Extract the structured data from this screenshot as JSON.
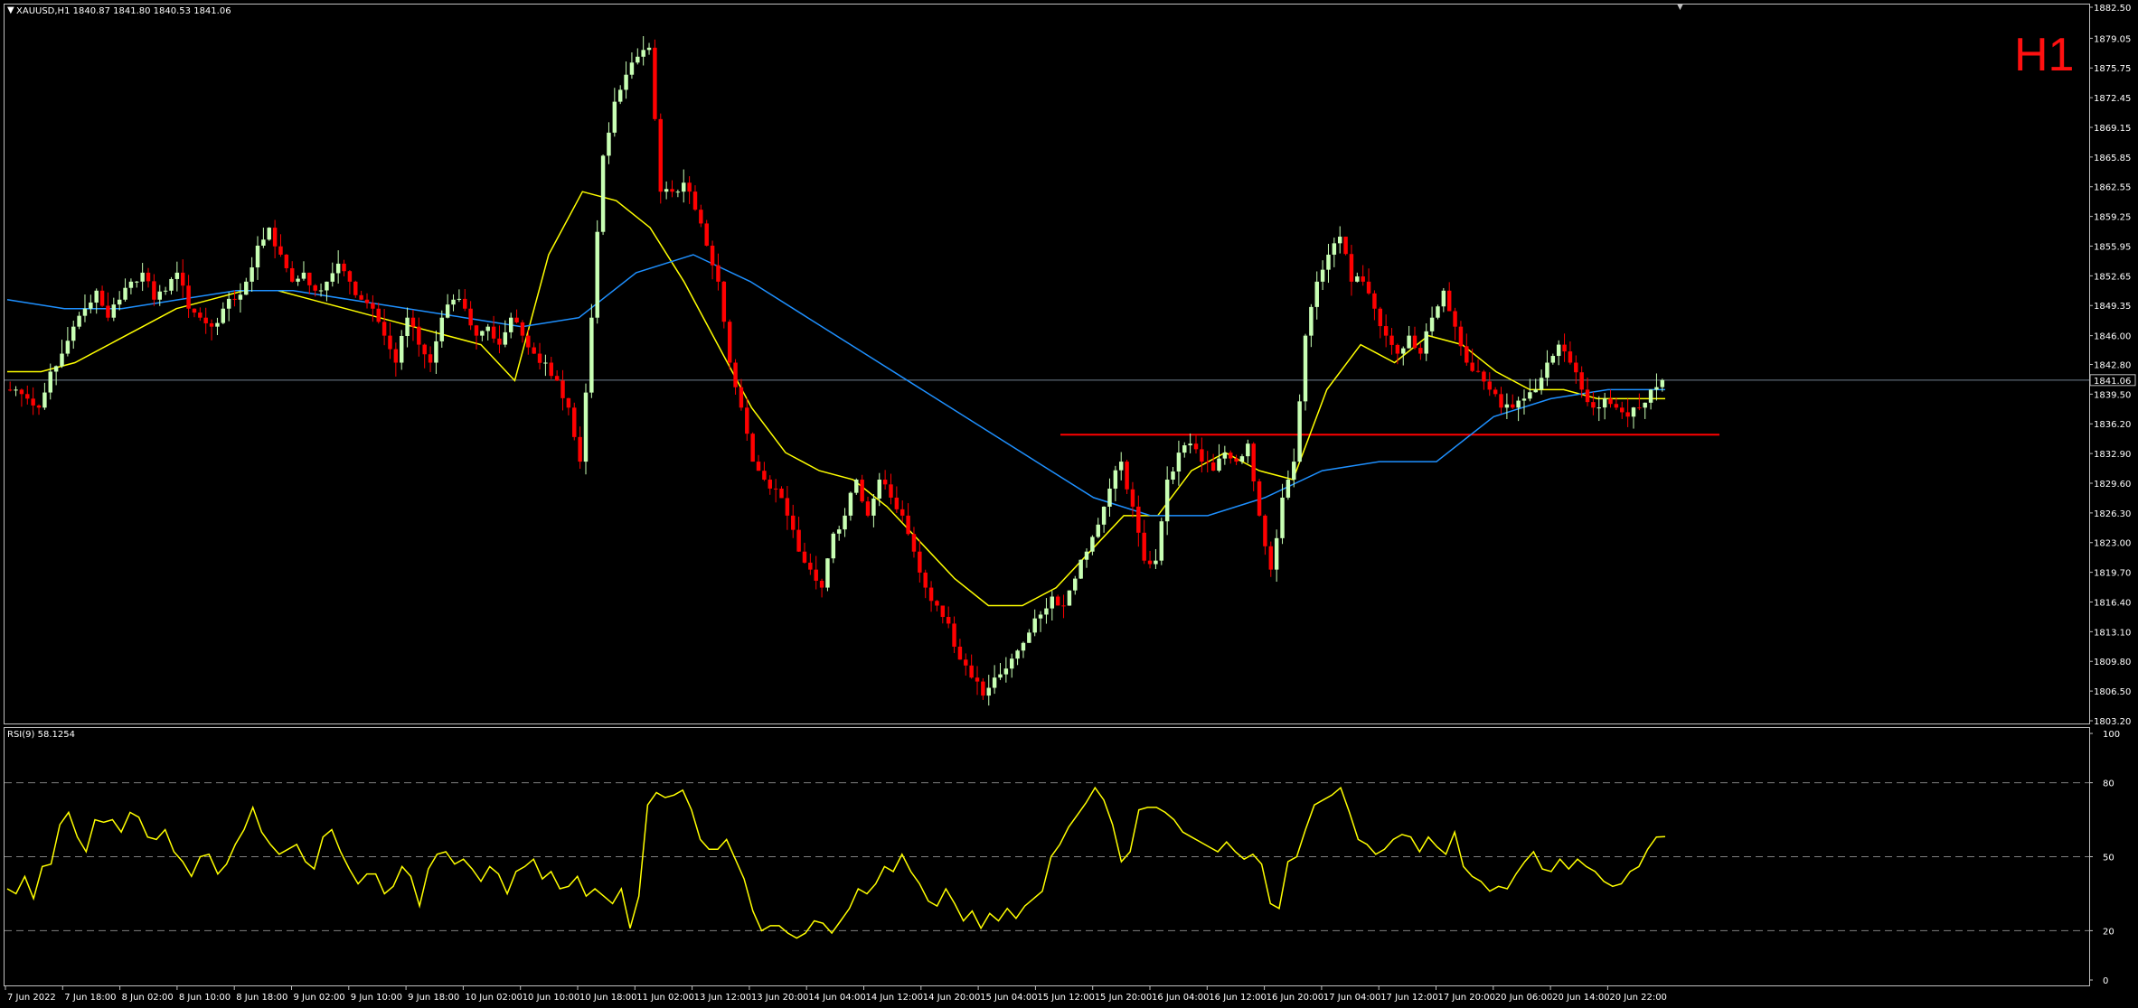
{
  "header": {
    "symbol_info": "XAUUSD,H1  1840.87 1841.80 1840.53 1841.06",
    "timeframe": "H1",
    "rsi_info": "RSI(9) 58.1254"
  },
  "colors": {
    "background": "#000000",
    "bull": "#c8ffb4",
    "bear": "#ff0000",
    "ma_fast": "#ffff00",
    "ma_slow": "#1e90ff",
    "rsi": "#ffff00",
    "support_line": "#ff0000",
    "current_price_line": "#708090"
  },
  "chart_data": [
    {
      "type": "candlestick",
      "symbol": "XAUUSD",
      "timeframe": "H1",
      "last": {
        "open": 1840.87,
        "high": 1841.8,
        "low": 1840.53,
        "close": 1841.06
      },
      "current_price_label": "1841.06",
      "ylim": [
        1803.2,
        1882.5
      ],
      "y_ticks": [
        "1882.50",
        "1879.05",
        "1875.75",
        "1872.45",
        "1869.15",
        "1865.85",
        "1862.55",
        "1859.25",
        "1855.95",
        "1852.65",
        "1849.35",
        "1846.00",
        "1842.80",
        "1839.50",
        "1836.20",
        "1832.90",
        "1829.60",
        "1826.30",
        "1823.00",
        "1819.70",
        "1816.40",
        "1813.10",
        "1809.80",
        "1806.50",
        "1803.20"
      ],
      "x_ticks": [
        "7 Jun 2022",
        "7 Jun 18:00",
        "8 Jun 02:00",
        "8 Jun 10:00",
        "8 Jun 18:00",
        "9 Jun 02:00",
        "9 Jun 10:00",
        "9 Jun 18:00",
        "10 Jun 02:00",
        "10 Jun 10:00",
        "10 Jun 18:00",
        "11 Jun 02:00",
        "13 Jun 12:00",
        "13 Jun 20:00",
        "14 Jun 04:00",
        "14 Jun 12:00",
        "14 Jun 20:00",
        "15 Jun 04:00",
        "15 Jun 12:00",
        "15 Jun 20:00",
        "16 Jun 04:00",
        "16 Jun 12:00",
        "16 Jun 20:00",
        "17 Jun 04:00",
        "17 Jun 12:00",
        "17 Jun 20:00",
        "20 Jun 06:00",
        "20 Jun 14:00",
        "20 Jun 22:00"
      ],
      "support_level": 1835.0,
      "series": [
        {
          "kind": "close_path",
          "values": [
            1840,
            1839,
            1838,
            1842,
            1844,
            1847,
            1849,
            1851,
            1848,
            1850,
            1852,
            1853,
            1850,
            1851,
            1853,
            1849,
            1848,
            1847,
            1849,
            1850,
            1852,
            1856,
            1858,
            1855,
            1852,
            1853,
            1851,
            1852,
            1854,
            1852,
            1850,
            1849,
            1846,
            1843,
            1848,
            1845,
            1843,
            1848,
            1850,
            1849,
            1846,
            1847,
            1845,
            1848,
            1846,
            1844,
            1843,
            1841,
            1838,
            1832,
            1848,
            1866,
            1872,
            1875,
            1877,
            1878,
            1862,
            1862,
            1863,
            1860,
            1856,
            1852,
            1843,
            1838,
            1832,
            1830,
            1829,
            1826,
            1822,
            1820,
            1818,
            1824,
            1826,
            1830,
            1826,
            1830,
            1828,
            1826,
            1822,
            1818,
            1816,
            1814,
            1810,
            1808,
            1806,
            1808,
            1809,
            1811,
            1813,
            1815,
            1817,
            1816,
            1819,
            1822,
            1825,
            1829,
            1832,
            1827,
            1821,
            1821,
            1830,
            1833,
            1834,
            1832,
            1831,
            1833,
            1832,
            1834,
            1826,
            1820,
            1828,
            1832,
            1846,
            1852,
            1855,
            1857,
            1852,
            1852,
            1849,
            1846,
            1844,
            1846,
            1844,
            1848,
            1851,
            1847,
            1843,
            1842,
            1840,
            1838,
            1838,
            1839,
            1840,
            1843,
            1845,
            1843,
            1840,
            1838,
            1839,
            1838,
            1837,
            1838,
            1840,
            1841.06
          ]
        },
        {
          "name": "",
          "kind": "ma_fast",
          "values": [
            1842,
            1842,
            1843,
            1845,
            1847,
            1849,
            1850,
            1851,
            1851,
            1850,
            1849,
            1848,
            1847,
            1846,
            1845,
            1841,
            1855,
            1862,
            1861,
            1858,
            1852,
            1845,
            1838,
            1833,
            1831,
            1830,
            1827,
            1823,
            1819,
            1816,
            1816,
            1818,
            1822,
            1826,
            1826,
            1831,
            1833,
            1831,
            1830,
            1840,
            1845,
            1843,
            1846,
            1845,
            1842,
            1840,
            1840,
            1839,
            1839,
            1839
          ]
        },
        {
          "name": "",
          "kind": "ma_slow",
          "values": [
            1850,
            1849,
            1849,
            1850,
            1851,
            1851,
            1850,
            1849,
            1848,
            1847,
            1848,
            1853,
            1855,
            1852,
            1848,
            1844,
            1840,
            1836,
            1832,
            1828,
            1826,
            1826,
            1828,
            1831,
            1832,
            1832,
            1837,
            1839,
            1840,
            1840
          ]
        }
      ]
    },
    {
      "type": "line",
      "indicator": "RSI(9)",
      "last_value": 58.1254,
      "ylim": [
        0,
        100
      ],
      "y_ticks": [
        "100",
        "80",
        "50",
        "20",
        "0"
      ],
      "levels": [
        80,
        50,
        20
      ],
      "values": [
        37,
        35,
        42,
        33,
        46,
        47,
        63,
        68,
        58,
        52,
        65,
        64,
        65,
        60,
        68,
        66,
        58,
        57,
        61,
        52,
        48,
        42,
        50,
        51,
        43,
        47,
        55,
        61,
        70,
        60,
        55,
        51,
        53,
        55,
        48,
        45,
        58,
        61,
        52,
        45,
        39,
        43,
        43,
        35,
        38,
        46,
        42,
        30,
        45,
        51,
        52,
        47,
        49,
        45,
        40,
        46,
        43,
        35,
        44,
        46,
        49,
        41,
        44,
        37,
        38,
        42,
        34,
        37,
        34,
        31,
        37,
        21,
        34,
        71,
        76,
        74,
        75,
        77,
        69,
        57,
        53,
        53,
        57,
        49,
        41,
        28,
        20,
        22,
        22,
        19,
        17,
        19,
        24,
        23,
        19,
        24,
        29,
        37,
        35,
        39,
        46,
        44,
        51,
        44,
        39,
        32,
        30,
        37,
        31,
        24,
        28,
        21,
        27,
        24,
        29,
        25,
        30,
        33,
        36,
        50,
        55,
        62,
        67,
        72,
        78,
        73,
        63,
        48,
        52,
        69,
        70,
        70,
        68,
        65,
        60,
        58,
        56,
        54,
        52,
        56,
        52,
        49,
        51,
        47,
        31,
        29,
        48,
        50,
        61,
        71,
        73,
        75,
        78,
        68,
        57,
        55,
        51,
        53,
        57,
        59,
        58,
        52,
        58,
        54,
        51,
        60,
        46,
        42,
        40,
        36,
        38,
        37,
        43,
        48,
        52,
        45,
        44,
        49,
        45,
        49,
        46,
        44,
        40,
        38,
        39,
        44,
        46,
        53,
        58,
        58.1254
      ]
    }
  ]
}
